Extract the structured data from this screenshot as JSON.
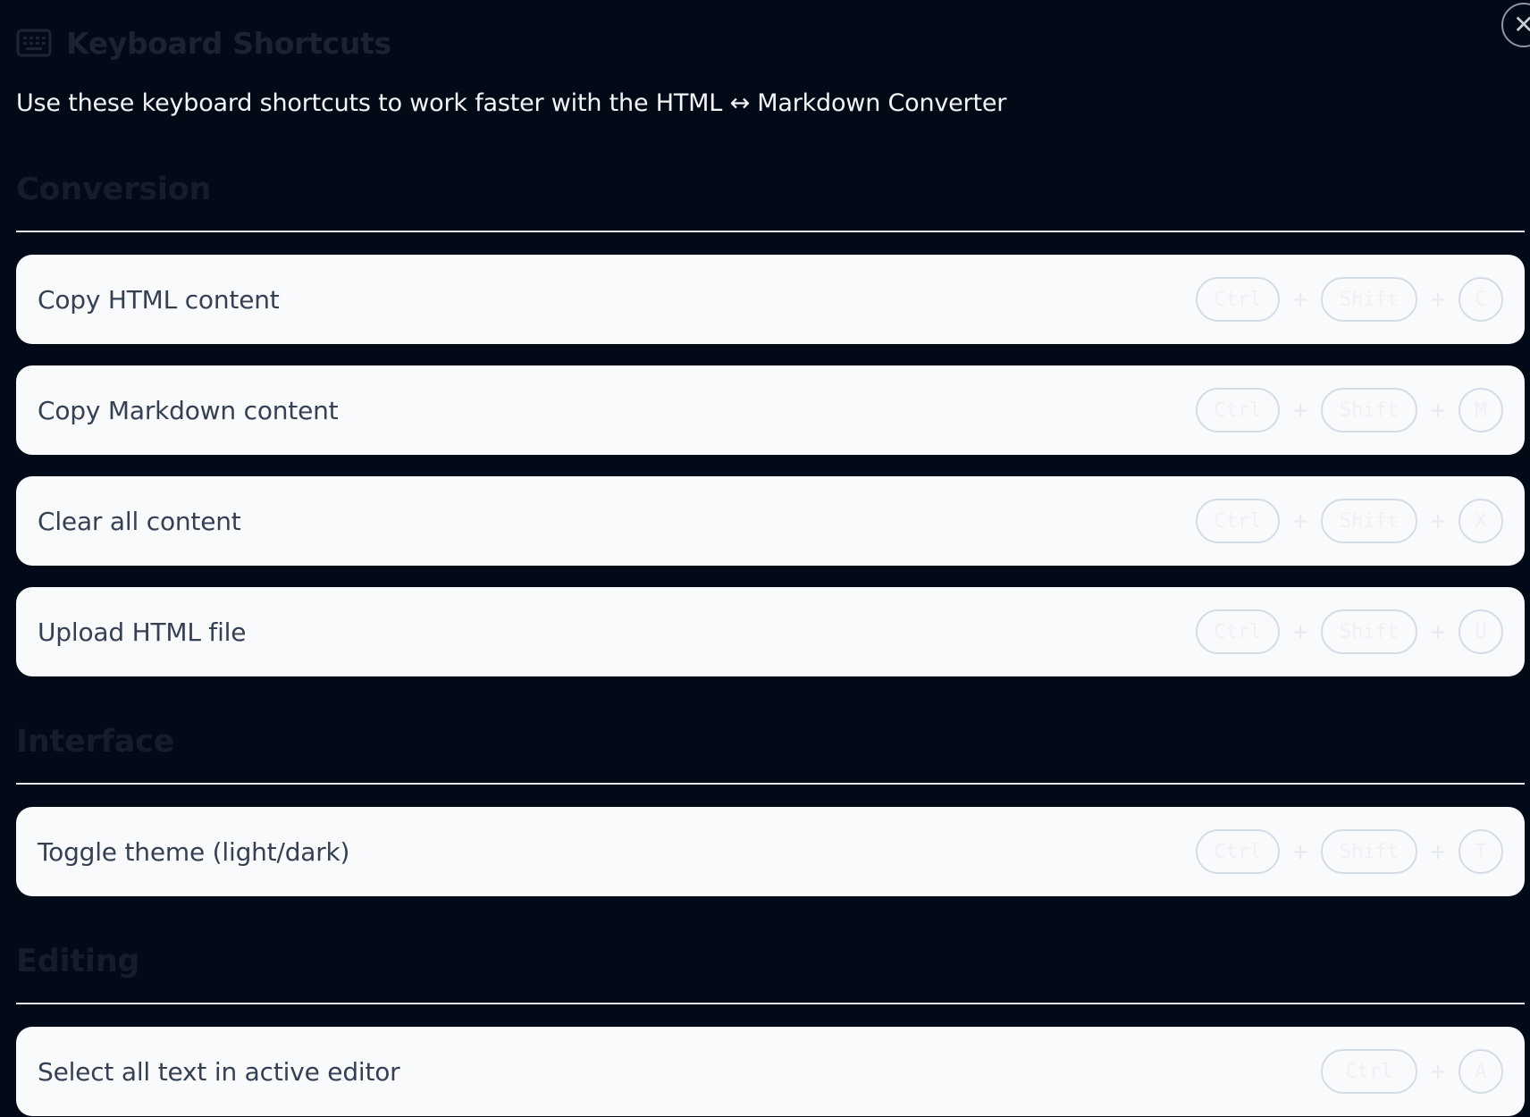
{
  "header": {
    "title": "Keyboard Shortcuts",
    "icon": "keyboard-icon",
    "close_icon": "close-icon"
  },
  "subtitle": "Use these keyboard shortcuts to work faster with the HTML ↔ Markdown Converter",
  "sections": [
    {
      "heading": "Conversion",
      "shortcuts": [
        {
          "label": "Copy HTML content",
          "keys": [
            "Ctrl",
            "Shift",
            "C"
          ]
        },
        {
          "label": "Copy Markdown content",
          "keys": [
            "Ctrl",
            "Shift",
            "M"
          ]
        },
        {
          "label": "Clear all content",
          "keys": [
            "Ctrl",
            "Shift",
            "X"
          ]
        },
        {
          "label": "Upload HTML file",
          "keys": [
            "Ctrl",
            "Shift",
            "U"
          ]
        }
      ]
    },
    {
      "heading": "Interface",
      "shortcuts": [
        {
          "label": "Toggle theme (light/dark)",
          "keys": [
            "Ctrl",
            "Shift",
            "T"
          ]
        }
      ]
    },
    {
      "heading": "Editing",
      "shortcuts": [
        {
          "label": "Select all text in active editor",
          "keys": [
            "Ctrl",
            "A"
          ]
        }
      ]
    }
  ],
  "key_separator": "+",
  "colors": {
    "background": "#030a17",
    "card": "#f8fafc",
    "card_text": "#354055",
    "divider": "#e8ebf0"
  }
}
